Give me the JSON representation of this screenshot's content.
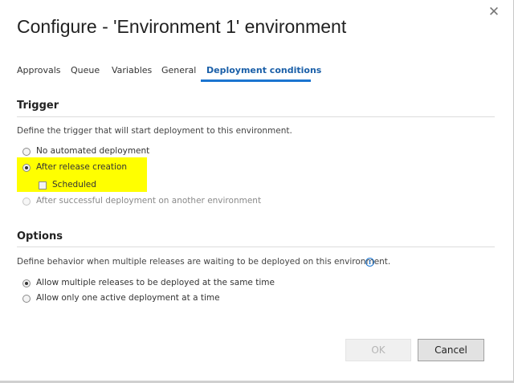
{
  "dialog": {
    "title": "Configure - 'Environment 1' environment",
    "close_glyph": "✕"
  },
  "tabs": [
    {
      "label": "Approvals",
      "active": false
    },
    {
      "label": "Queue",
      "active": false
    },
    {
      "label": "Variables",
      "active": false
    },
    {
      "label": "General",
      "active": false
    },
    {
      "label": "Deployment conditions",
      "active": true
    }
  ],
  "trigger": {
    "heading": "Trigger",
    "description": "Define the trigger that will start deployment to this environment.",
    "options": [
      {
        "label": "No automated deployment",
        "selected": false,
        "enabled": true
      },
      {
        "label": "After release creation",
        "selected": true,
        "enabled": true
      },
      {
        "label": "After successful deployment on another environment",
        "selected": false,
        "enabled": false
      }
    ],
    "scheduled": {
      "label": "Scheduled",
      "checked": false
    }
  },
  "options_section": {
    "heading": "Options",
    "description": "Define behavior when multiple releases are waiting to be deployed on this environment.",
    "info_glyph": "i",
    "options": [
      {
        "label": "Allow multiple releases to be deployed at the same time",
        "selected": true
      },
      {
        "label": "Allow only one active deployment at a time",
        "selected": false
      }
    ]
  },
  "buttons": {
    "ok_label": "OK",
    "ok_enabled": false,
    "cancel_label": "Cancel"
  },
  "colors": {
    "accent": "#1b75d0",
    "highlight": "#ffff00"
  },
  "icons": {
    "close": "close-icon",
    "info": "info-icon"
  }
}
